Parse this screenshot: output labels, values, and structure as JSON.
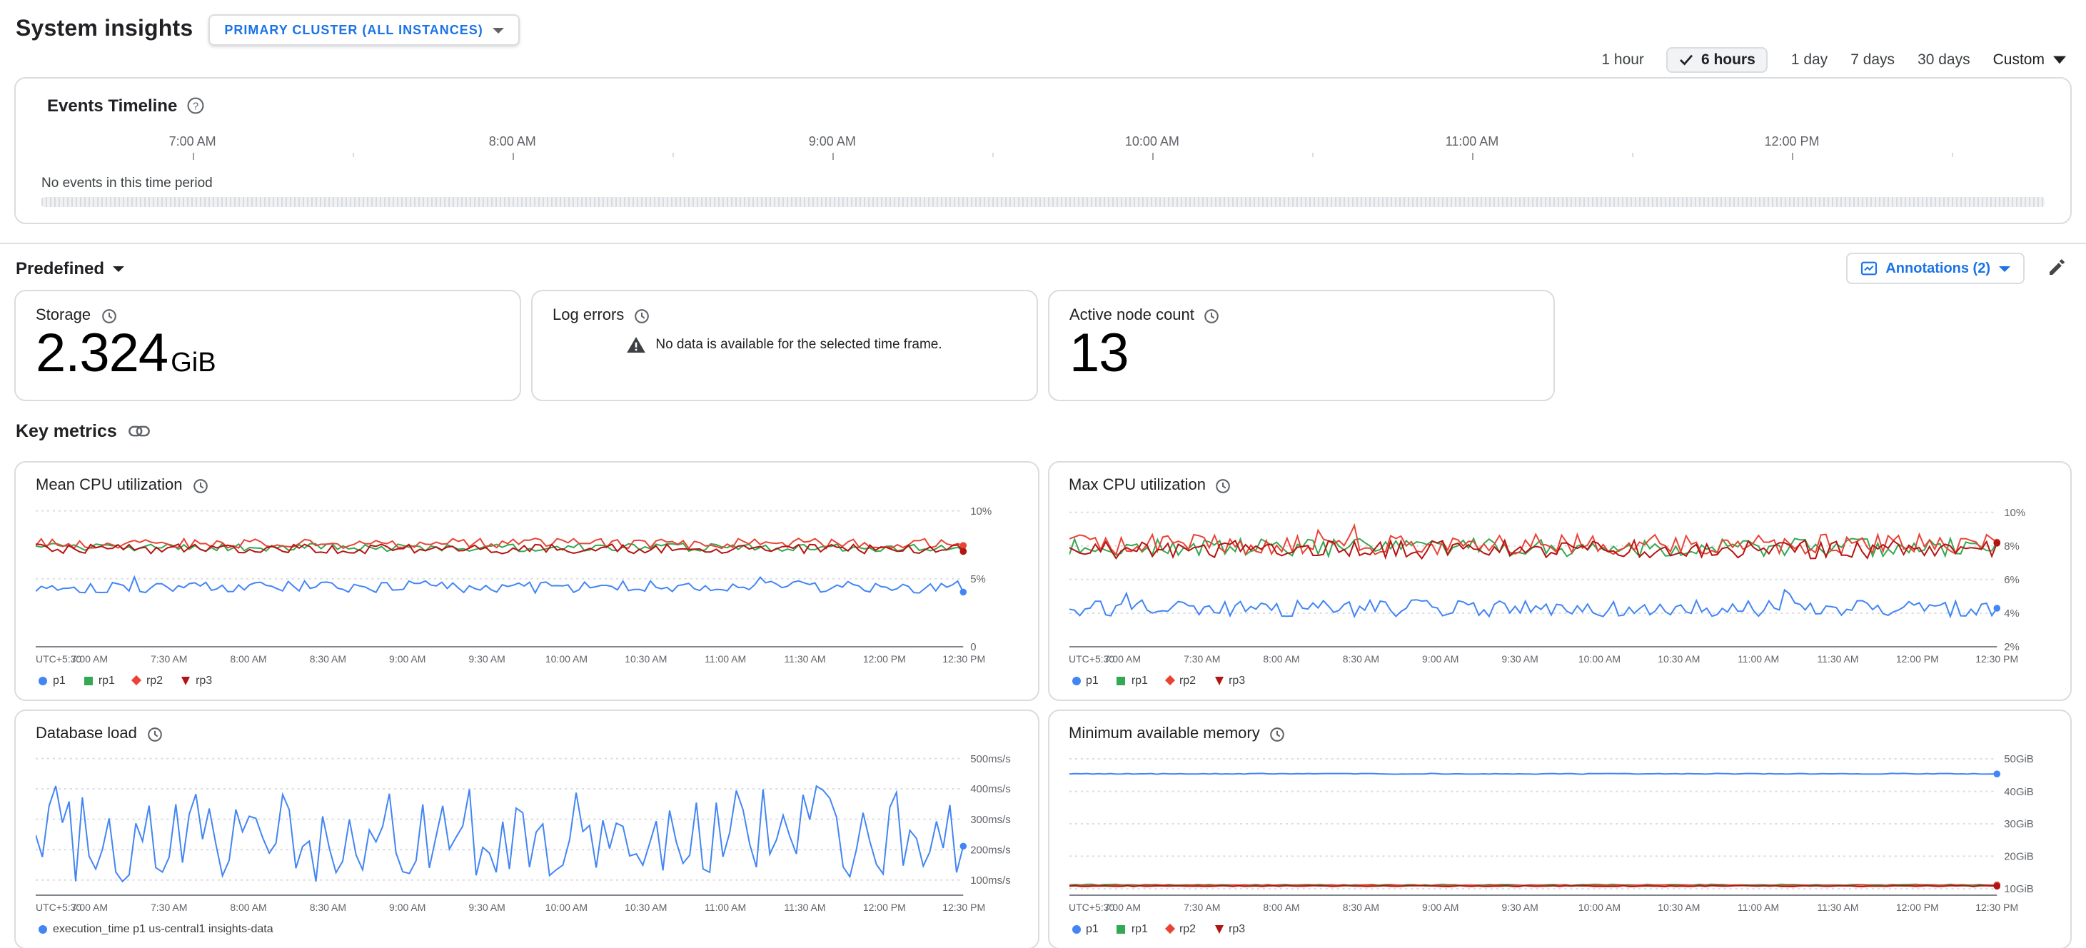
{
  "header": {
    "title": "System insights",
    "cluster_selector_label": "PRIMARY CLUSTER (ALL INSTANCES)"
  },
  "time_range": {
    "options": [
      "1 hour",
      "6 hours",
      "1 day",
      "7 days",
      "30 days"
    ],
    "selected": "6 hours",
    "custom_label": "Custom"
  },
  "events_timeline": {
    "title": "Events Timeline",
    "hour_labels": [
      "7:00 AM",
      "8:00 AM",
      "9:00 AM",
      "10:00 AM",
      "11:00 AM",
      "12:00 PM"
    ],
    "empty_message": "No events in this time period"
  },
  "controls": {
    "predefined_label": "Predefined",
    "annotations_label": "Annotations (2)"
  },
  "summary_cards": {
    "storage": {
      "title": "Storage",
      "value": "2.324",
      "unit": "GiB"
    },
    "log_errors": {
      "title": "Log errors",
      "no_data_message": "No data is available for the selected time frame."
    },
    "active_nodes": {
      "title": "Active node count",
      "value": "13"
    }
  },
  "key_metrics_title": "Key metrics",
  "colors": {
    "accent_blue": "#1a73e8",
    "grid_line": "#dadce0",
    "axis_line": "#80868b",
    "series_p1": "#4285f4",
    "series_rp1": "#34a853",
    "series_rp2": "#ea4335",
    "series_rp3": "#b31412"
  },
  "chart_data": [
    {
      "type": "line",
      "title": "Mean CPU utilization",
      "legend_position": "bottom",
      "grid": true,
      "y_axis": {
        "min": 0,
        "max": 10.5,
        "unit": "%",
        "side": "right",
        "ticks": [
          {
            "value": 10,
            "label": "10%"
          },
          {
            "value": 5,
            "label": "5%"
          },
          {
            "value": 0,
            "label": "0"
          }
        ]
      },
      "x_labels": [
        "UTC+5:30",
        "7:00 AM",
        "7:30 AM",
        "8:00 AM",
        "8:30 AM",
        "9:00 AM",
        "9:30 AM",
        "10:00 AM",
        "10:30 AM",
        "11:00 AM",
        "11:30 AM",
        "12:00 PM",
        "12:30 PM"
      ],
      "series": [
        {
          "name": "p1",
          "color": "#4285f4",
          "marker": "circle",
          "approx_mean": 4.4,
          "approx_range": [
            3.5,
            5.8
          ],
          "gen": {
            "base": 4.4,
            "noise": 0.45,
            "spike": 1.1,
            "points": 170,
            "seed": 101
          }
        },
        {
          "name": "rp1",
          "color": "#34a853",
          "marker": "square",
          "approx_mean": 7.3,
          "approx_range": [
            6.8,
            7.9
          ],
          "gen": {
            "base": 7.3,
            "noise": 0.3,
            "points": 170,
            "seed": 102
          }
        },
        {
          "name": "rp2",
          "color": "#ea4335",
          "marker": "diamond",
          "approx_mean": 7.6,
          "approx_range": [
            7.0,
            8.3
          ],
          "gen": {
            "base": 7.6,
            "noise": 0.38,
            "points": 170,
            "seed": 103
          }
        },
        {
          "name": "rp3",
          "color": "#b31412",
          "marker": "triangle-down",
          "approx_mean": 7.2,
          "approx_range": [
            6.6,
            7.8
          ],
          "gen": {
            "base": 7.2,
            "noise": 0.35,
            "points": 170,
            "seed": 104
          }
        }
      ]
    },
    {
      "type": "line",
      "title": "Max CPU utilization",
      "legend_position": "bottom",
      "grid": true,
      "y_axis": {
        "min": 2,
        "max": 10.5,
        "unit": "%",
        "side": "right",
        "ticks": [
          {
            "value": 10,
            "label": "10%"
          },
          {
            "value": 8,
            "label": "8%"
          },
          {
            "value": 6,
            "label": "6%"
          },
          {
            "value": 4,
            "label": "4%"
          },
          {
            "value": 2,
            "label": "2%"
          }
        ]
      },
      "x_labels": [
        "UTC+5:30",
        "7:00 AM",
        "7:30 AM",
        "8:00 AM",
        "8:30 AM",
        "9:00 AM",
        "9:30 AM",
        "10:00 AM",
        "10:30 AM",
        "11:00 AM",
        "11:30 AM",
        "12:00 PM",
        "12:30 PM"
      ],
      "series": [
        {
          "name": "p1",
          "color": "#4285f4",
          "marker": "circle",
          "approx_mean": 4.3,
          "approx_range": [
            3.3,
            5.5
          ],
          "gen": {
            "base": 4.3,
            "noise": 0.5,
            "spike": 0.9,
            "points": 180,
            "seed": 201
          }
        },
        {
          "name": "rp1",
          "color": "#34a853",
          "marker": "square",
          "approx_mean": 7.9,
          "approx_range": [
            7.0,
            9.0
          ],
          "gen": {
            "base": 7.9,
            "noise": 0.55,
            "points": 180,
            "seed": 202
          }
        },
        {
          "name": "rp2",
          "color": "#ea4335",
          "marker": "diamond",
          "approx_mean": 8.1,
          "approx_range": [
            7.2,
            9.6
          ],
          "gen": {
            "base": 8.1,
            "noise": 0.6,
            "spike": 0.9,
            "points": 180,
            "seed": 203
          }
        },
        {
          "name": "rp3",
          "color": "#b31412",
          "marker": "triangle-down",
          "approx_mean": 7.8,
          "approx_range": [
            6.9,
            8.9
          ],
          "gen": {
            "base": 7.8,
            "noise": 0.55,
            "points": 180,
            "seed": 204
          }
        }
      ]
    },
    {
      "type": "line",
      "title": "Database load",
      "legend_position": "bottom",
      "grid": true,
      "y_axis": {
        "min": 50,
        "max": 520,
        "unit": "ms/s",
        "side": "right",
        "ticks": [
          {
            "value": 500,
            "label": "500ms/s"
          },
          {
            "value": 400,
            "label": "400ms/s"
          },
          {
            "value": 300,
            "label": "300ms/s"
          },
          {
            "value": 200,
            "label": "200ms/s"
          },
          {
            "value": 100,
            "label": "100ms/s"
          }
        ]
      },
      "x_labels": [
        "UTC+5:30",
        "7:00 AM",
        "7:30 AM",
        "8:00 AM",
        "8:30 AM",
        "9:00 AM",
        "9:30 AM",
        "10:00 AM",
        "10:30 AM",
        "11:00 AM",
        "11:30 AM",
        "12:00 PM",
        "12:30 PM"
      ],
      "series": [
        {
          "name": "execution_time p1 us-central1 insights-data",
          "color": "#4285f4",
          "marker": "circle",
          "approx_mean": 250,
          "approx_range": [
            100,
            420
          ],
          "gen": {
            "base": 250,
            "noise": 160,
            "points": 140,
            "seed": 301,
            "clamp": [
              95,
              435
            ]
          }
        }
      ]
    },
    {
      "type": "line",
      "title": "Minimum available memory",
      "legend_position": "bottom",
      "grid": true,
      "y_axis": {
        "min": 8,
        "max": 52,
        "unit": "GiB",
        "side": "right",
        "ticks": [
          {
            "value": 50,
            "label": "50GiB"
          },
          {
            "value": 40,
            "label": "40GiB"
          },
          {
            "value": 30,
            "label": "30GiB"
          },
          {
            "value": 20,
            "label": "20GiB"
          },
          {
            "value": 10,
            "label": "10GiB"
          }
        ]
      },
      "x_labels": [
        "UTC+5:30",
        "7:00 AM",
        "7:30 AM",
        "8:00 AM",
        "8:30 AM",
        "9:00 AM",
        "9:30 AM",
        "10:00 AM",
        "10:30 AM",
        "11:00 AM",
        "11:30 AM",
        "12:00 PM",
        "12:30 PM"
      ],
      "series": [
        {
          "name": "p1",
          "color": "#4285f4",
          "marker": "circle",
          "approx_mean": 45.4,
          "gen": {
            "base": 45.4,
            "noise": 0.12,
            "points": 160,
            "seed": 401
          }
        },
        {
          "name": "rp1",
          "color": "#34a853",
          "marker": "square",
          "approx_mean": 11.2,
          "gen": {
            "base": 11.2,
            "noise": 0.15,
            "points": 160,
            "seed": 402
          }
        },
        {
          "name": "rp2",
          "color": "#ea4335",
          "marker": "diamond",
          "approx_mean": 11.0,
          "gen": {
            "base": 11.0,
            "noise": 0.15,
            "points": 160,
            "seed": 403
          }
        },
        {
          "name": "rp3",
          "color": "#b31412",
          "marker": "triangle-down",
          "approx_mean": 10.8,
          "gen": {
            "base": 10.8,
            "noise": 0.15,
            "points": 160,
            "seed": 404
          }
        }
      ]
    }
  ]
}
